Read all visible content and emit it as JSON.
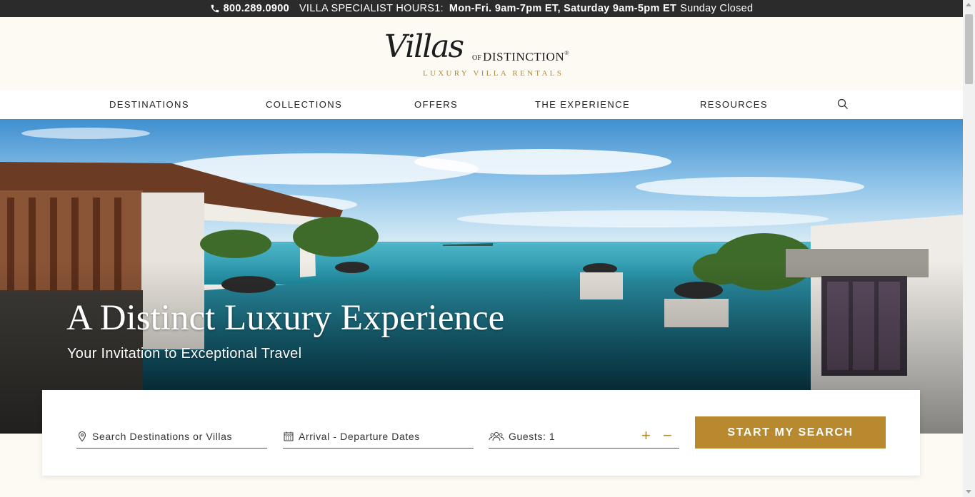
{
  "topbar": {
    "phone": "800.289.0900",
    "hours_label": "VILLA SPECIALIST HOURS1:",
    "hours_weekday": "Mon-Fri. 9am-7pm ET, Saturday 9am-5pm ET",
    "hours_sunday": "Sunday Closed"
  },
  "logo": {
    "script": "Villas",
    "of": "OF",
    "distinction": "DISTINCTION",
    "registered": "®",
    "tagline": "LUXURY VILLA RENTALS"
  },
  "nav": {
    "items": [
      {
        "label": "DESTINATIONS"
      },
      {
        "label": "COLLECTIONS"
      },
      {
        "label": "OFFERS"
      },
      {
        "label": "THE EXPERIENCE"
      },
      {
        "label": "RESOURCES"
      }
    ],
    "search_icon": "search-icon"
  },
  "hero": {
    "title": "A Distinct Luxury Experience",
    "subtitle": "Your Invitation to Exceptional Travel"
  },
  "search": {
    "destination_placeholder": "Search Destinations or Villas",
    "dates_placeholder": "Arrival - Departure Dates",
    "guests_label": "Guests: 1",
    "plus": "+",
    "minus": "−",
    "button_label": "START MY SEARCH"
  },
  "colors": {
    "accent_gold": "#b8892f",
    "topbar_bg": "#2b2b2b",
    "header_bg": "#fdfaf3"
  }
}
